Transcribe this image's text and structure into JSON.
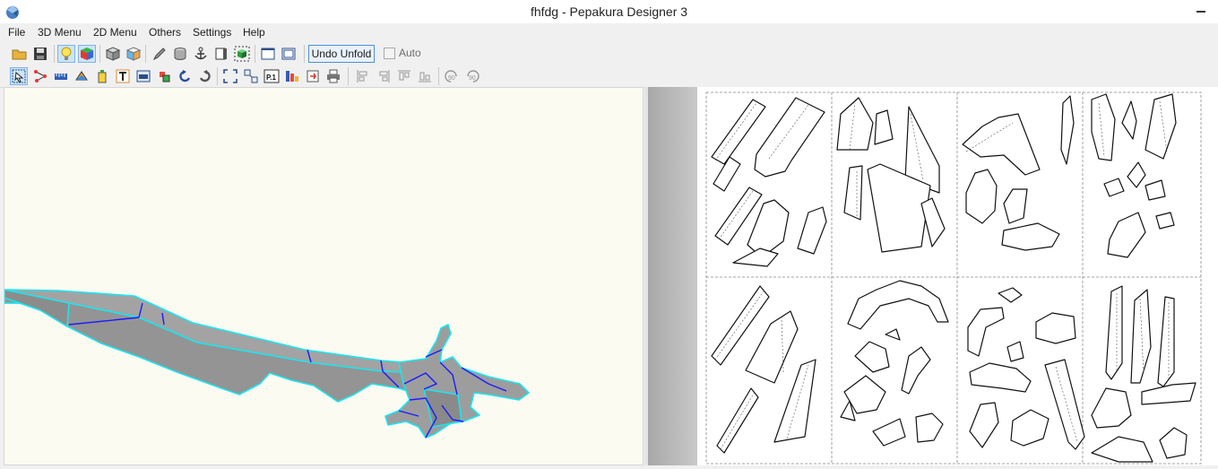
{
  "window": {
    "title": "fhfdg - Pepakura Designer 3"
  },
  "menu": {
    "items": [
      "File",
      "3D Menu",
      "2D Menu",
      "Others",
      "Settings",
      "Help"
    ]
  },
  "toolbar1": {
    "undo_unfold_label": "Undo Unfold",
    "auto_label": "Auto",
    "auto_checked": false
  },
  "toolbar2": {
    "page_number_icon_text": "P.1",
    "rotate_ccw_text": "90",
    "rotate_cw_text": "90"
  },
  "colors": {
    "model_fill": "#a0a0a0",
    "model_edge": "#19e6f0",
    "model_fold": "#1a1aff",
    "view3d_bg": "#fbfbf2",
    "page_border": "#888888"
  },
  "layout_sheet": {
    "pages": 8,
    "rows": 2,
    "cols": 4
  }
}
